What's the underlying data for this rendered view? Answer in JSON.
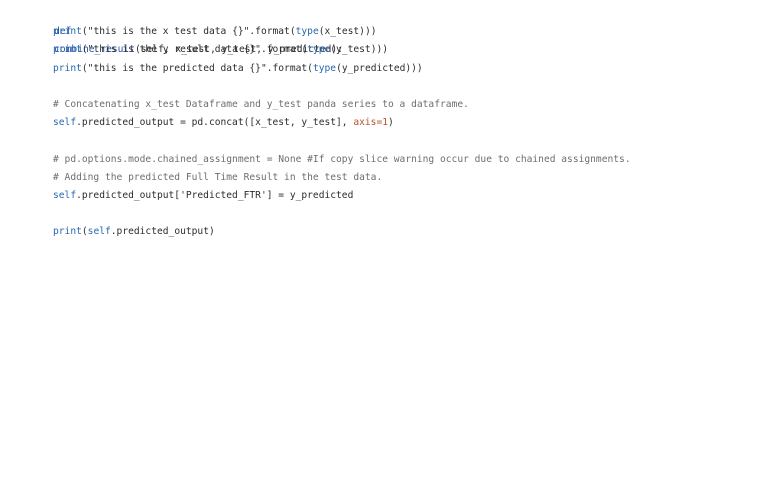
{
  "code": {
    "line1": {
      "kw": "def",
      "name": "combine_result",
      "params": "(self, x_test, y_test, y_predicted):"
    },
    "line2": {
      "fn": "print",
      "open": "(",
      "str": "\"this is the x test data {}\"",
      "fmt": ".format(",
      "type": "type",
      "rest": "(x_test)))"
    },
    "line3": {
      "fn": "print",
      "open": "(",
      "str": "\"this is the y result data {}\"",
      "fmt": ".format(",
      "type": "type",
      "rest": "(y_test)))"
    },
    "line4": {
      "fn": "print",
      "open": "(",
      "str": "\"this is the predicted data {}\"",
      "fmt": ".format(",
      "type": "type",
      "rest": "(y_predicted)))"
    },
    "line6": {
      "comment": "# Concatenating x_test Dataframe and y_test panda series to a dataframe."
    },
    "line7": {
      "self": "self",
      "mid": ".predicted_output = pd.concat([x_test, y_test], ",
      "kwarg": "axis",
      "eq": "=",
      "num": "1",
      "close": ")"
    },
    "line9": {
      "comment": "# pd.options.mode.chained_assignment = None #If copy slice warning occur due to chained assignments."
    },
    "line10": {
      "comment": "# Adding the predicted Full Time Result in the test data."
    },
    "line11": {
      "self": "self",
      "rest": ".predicted_output['Predicted_FTR'] = y_predicted"
    },
    "line13": {
      "fn": "print",
      "open": "(",
      "self": "self",
      "rest": ".predicted_output)"
    }
  },
  "colors": {
    "keyword": "#1f4fa5",
    "builtin": "#2a67b0",
    "kwarg": "#b6542b",
    "comment": "#6e6e6e",
    "text": "#2c2c2c"
  }
}
